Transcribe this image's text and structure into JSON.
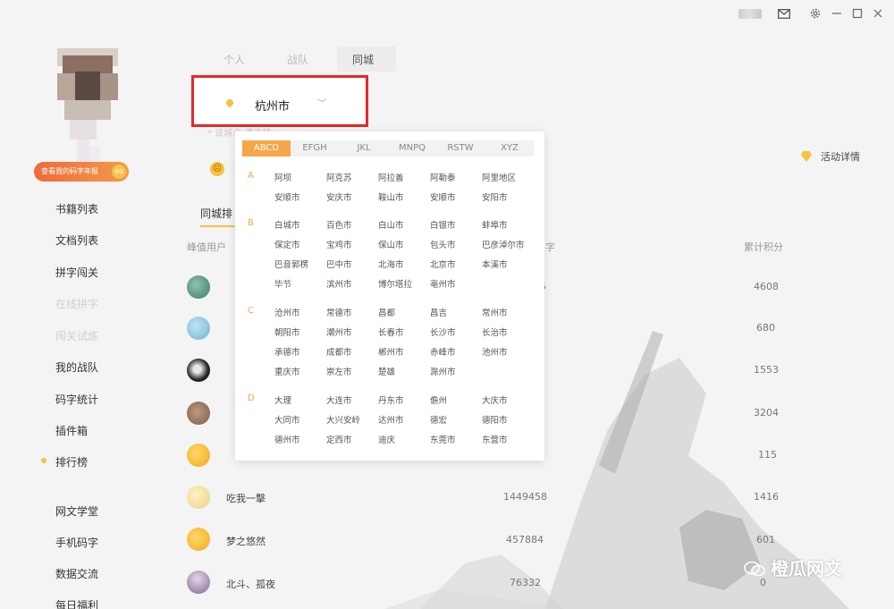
{
  "titlebar": {
    "icons": [
      "mail-icon",
      "gear-icon",
      "minimize-icon",
      "maximize-icon",
      "close-icon"
    ]
  },
  "sidebar": {
    "vip_label": "查看我的码字年报",
    "vip_level": "60",
    "items": [
      {
        "label": "书籍列表"
      },
      {
        "label": "文档列表"
      },
      {
        "label": "拼字闯关"
      },
      {
        "label": "在线拼字"
      },
      {
        "label": "闯关试炼"
      },
      {
        "label": "我的战队"
      },
      {
        "label": "码字统计"
      },
      {
        "label": "插件箱"
      },
      {
        "label": "排行榜"
      },
      {
        "label": "网文学堂"
      },
      {
        "label": "手机码字"
      },
      {
        "label": "数据交流"
      },
      {
        "label": "每日福利"
      }
    ]
  },
  "tabs": [
    {
      "label": "个人"
    },
    {
      "label": "战队"
    },
    {
      "label": "同城"
    }
  ],
  "city_select": {
    "value": "杭州市"
  },
  "hint": "* 该城市 请选择",
  "activity_label": "活动详情",
  "sub_tab": "同城排",
  "table": {
    "columns": {
      "user": "峰值用户",
      "count": "字",
      "score": "累计积分"
    },
    "rows": [
      {
        "name": "",
        "count": "5",
        "score": "4608"
      },
      {
        "name": "",
        "count": "",
        "score": "680"
      },
      {
        "name": "",
        "count": "",
        "score": "1553"
      },
      {
        "name": "",
        "count": "",
        "score": "3204"
      },
      {
        "name": "",
        "count": "",
        "score": "115"
      },
      {
        "name": "吃我一擊",
        "count": "1449458",
        "score": "1416"
      },
      {
        "name": "梦之悠然",
        "count": "457884",
        "score": "601"
      },
      {
        "name": "北斗、孤夜",
        "count": "76332",
        "score": "0"
      }
    ]
  },
  "dropdown": {
    "tabs": [
      "ABCD",
      "EFGH",
      "JKL",
      "MNPQ",
      "RSTW",
      "XYZ"
    ],
    "groups": [
      {
        "letter": "A",
        "cities": [
          "阿坝",
          "阿克苏",
          "阿拉善",
          "阿勒泰",
          "阿里地区",
          "安顺市",
          "安庆市",
          "鞍山市",
          "安顺市",
          "安阳市"
        ]
      },
      {
        "letter": "B",
        "cities": [
          "白城市",
          "百色市",
          "白山市",
          "白银市",
          "蚌埠市",
          "保定市",
          "宝鸡市",
          "保山市",
          "包头市",
          "巴彦淖尔市",
          "巴音郭楞",
          "巴中市",
          "北海市",
          "北京市",
          "本溪市",
          "毕节",
          "滨州市",
          "博尔塔拉",
          "亳州市"
        ]
      },
      {
        "letter": "C",
        "cities": [
          "沧州市",
          "常德市",
          "昌都",
          "昌吉",
          "常州市",
          "朝阳市",
          "潮州市",
          "长春市",
          "长沙市",
          "长治市",
          "承德市",
          "成都市",
          "郴州市",
          "赤峰市",
          "池州市",
          "重庆市",
          "崇左市",
          "楚雄",
          "滁州市"
        ]
      },
      {
        "letter": "D",
        "cities": [
          "大理",
          "大连市",
          "丹东市",
          "儋州",
          "大庆市",
          "大同市",
          "大兴安岭",
          "达州市",
          "德宏",
          "德阳市",
          "德州市",
          "定西市",
          "迪庆",
          "东莞市",
          "东营市"
        ]
      }
    ]
  },
  "watermark": "橙瓜网文"
}
